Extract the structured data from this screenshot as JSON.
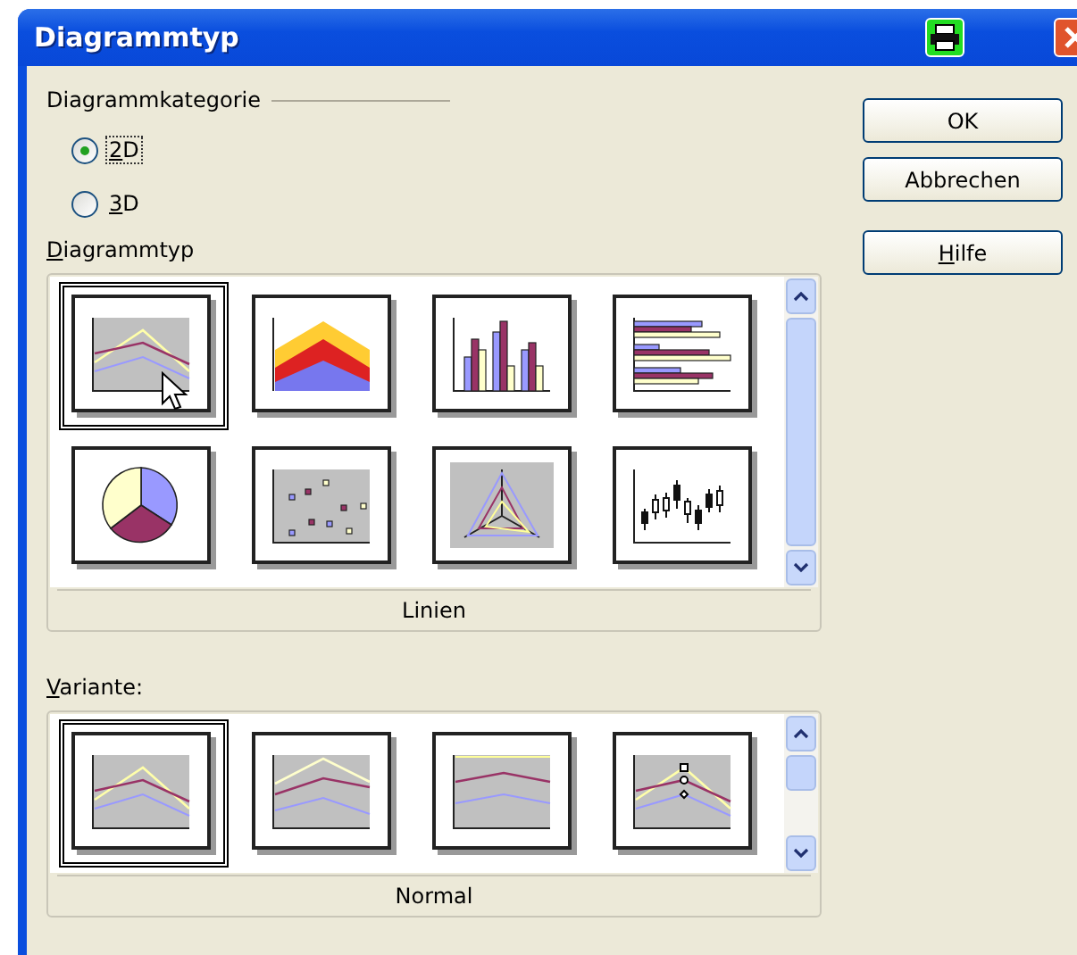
{
  "window": {
    "title": "Diagrammtyp"
  },
  "category": {
    "label": "Diagrammkategorie",
    "options": [
      {
        "access_key": "2",
        "label": "D",
        "selected": true
      },
      {
        "access_key": "3",
        "label": "D",
        "selected": false
      }
    ]
  },
  "chart_types": {
    "access_key": "D",
    "label": "iagrammtyp",
    "caption": "Linien",
    "items": [
      {
        "kind": "line",
        "selected": true
      },
      {
        "kind": "area",
        "selected": false
      },
      {
        "kind": "column",
        "selected": false
      },
      {
        "kind": "bar",
        "selected": false
      },
      {
        "kind": "pie",
        "selected": false
      },
      {
        "kind": "scatter",
        "selected": false
      },
      {
        "kind": "net",
        "selected": false
      },
      {
        "kind": "stock",
        "selected": false
      }
    ]
  },
  "variants": {
    "access_key": "V",
    "label": "ariante:",
    "caption": "Normal",
    "items": [
      {
        "kind": "line",
        "selected": true
      },
      {
        "kind": "line-stacked",
        "selected": false
      },
      {
        "kind": "line-percent",
        "selected": false
      },
      {
        "kind": "line-symbols",
        "selected": false
      }
    ]
  },
  "buttons": [
    {
      "label": "OK"
    },
    {
      "label": "Abbrechen"
    },
    {
      "access_key": "H",
      "label": "ilfe"
    }
  ]
}
